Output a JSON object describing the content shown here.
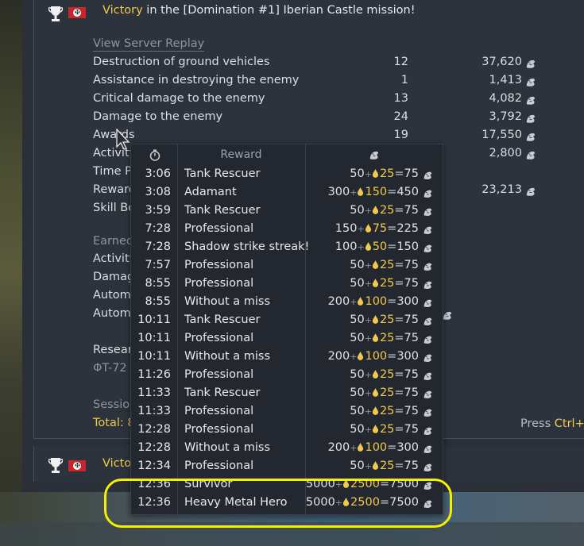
{
  "colors": {
    "accent_gold": "#f2c94c",
    "highlight": "#f5f000",
    "panel": "#2d333c"
  },
  "entry1": {
    "title_prefix": "Victory",
    "title_rest": " in the [Domination #1] Iberian Castle mission!",
    "replay_link": "View Server Replay",
    "stats": [
      {
        "label": "Destruction of ground vehicles",
        "count": "12",
        "value": "37,620"
      },
      {
        "label": "Assistance in destroying the enemy",
        "count": "1",
        "value": "1,413"
      },
      {
        "label": "Critical damage to the enemy",
        "count": "13",
        "value": "4,082"
      },
      {
        "label": "Damage to the enemy",
        "count": "24",
        "value": "3,792"
      },
      {
        "label": "Awards",
        "count": "19",
        "value": "17,550"
      },
      {
        "label": "Activity",
        "count": "",
        "value": "2,800"
      },
      {
        "label": "Time P",
        "count": "",
        "value": ""
      },
      {
        "label": "Reward",
        "count": "",
        "value": "23,213"
      },
      {
        "label": "Skill Bo",
        "count": "",
        "value": ""
      }
    ],
    "earned_lines": [
      "Earned",
      "Activity",
      "Damag",
      "Autom",
      "Autom"
    ],
    "research_lines": [
      "Resear",
      "ΦT-72"
    ],
    "session_label": "Session",
    "total_label": "Total: 8",
    "press_prefix": "Press ",
    "press_key": "Ctrl+C"
  },
  "entry2": {
    "title_prefix": "Victo"
  },
  "tooltip": {
    "header_time_icon": "stopwatch-icon",
    "header_reward": "Reward",
    "header_currency_icon": "silver-lions-icon",
    "rows": [
      {
        "time": "3:06",
        "name": "Tank Rescuer",
        "base": "50",
        "bonus": "25",
        "total": "75"
      },
      {
        "time": "3:08",
        "name": "Adamant",
        "base": "300",
        "bonus": "150",
        "total": "450"
      },
      {
        "time": "3:59",
        "name": "Tank Rescuer",
        "base": "50",
        "bonus": "25",
        "total": "75"
      },
      {
        "time": "7:28",
        "name": "Professional",
        "base": "150",
        "bonus": "75",
        "total": "225"
      },
      {
        "time": "7:28",
        "name": "Shadow strike streak!",
        "base": "100",
        "bonus": "50",
        "total": "150"
      },
      {
        "time": "7:57",
        "name": "Professional",
        "base": "50",
        "bonus": "25",
        "total": "75"
      },
      {
        "time": "8:55",
        "name": "Professional",
        "base": "50",
        "bonus": "25",
        "total": "75"
      },
      {
        "time": "8:55",
        "name": "Without a miss",
        "base": "200",
        "bonus": "100",
        "total": "300"
      },
      {
        "time": "10:11",
        "name": "Tank Rescuer",
        "base": "50",
        "bonus": "25",
        "total": "75"
      },
      {
        "time": "10:11",
        "name": "Professional",
        "base": "50",
        "bonus": "25",
        "total": "75"
      },
      {
        "time": "10:11",
        "name": "Without a miss",
        "base": "200",
        "bonus": "100",
        "total": "300"
      },
      {
        "time": "11:26",
        "name": "Professional",
        "base": "50",
        "bonus": "25",
        "total": "75"
      },
      {
        "time": "11:33",
        "name": "Tank Rescuer",
        "base": "50",
        "bonus": "25",
        "total": "75"
      },
      {
        "time": "11:33",
        "name": "Professional",
        "base": "50",
        "bonus": "25",
        "total": "75"
      },
      {
        "time": "12:28",
        "name": "Professional",
        "base": "50",
        "bonus": "25",
        "total": "75"
      },
      {
        "time": "12:28",
        "name": "Without a miss",
        "base": "200",
        "bonus": "100",
        "total": "300"
      },
      {
        "time": "12:34",
        "name": "Professional",
        "base": "50",
        "bonus": "25",
        "total": "75"
      },
      {
        "time": "12:36",
        "name": "Survivor",
        "base": "5000",
        "bonus": "2500",
        "total": "7500"
      },
      {
        "time": "12:36",
        "name": "Heavy Metal Hero",
        "base": "5000",
        "bonus": "2500",
        "total": "7500"
      }
    ]
  }
}
